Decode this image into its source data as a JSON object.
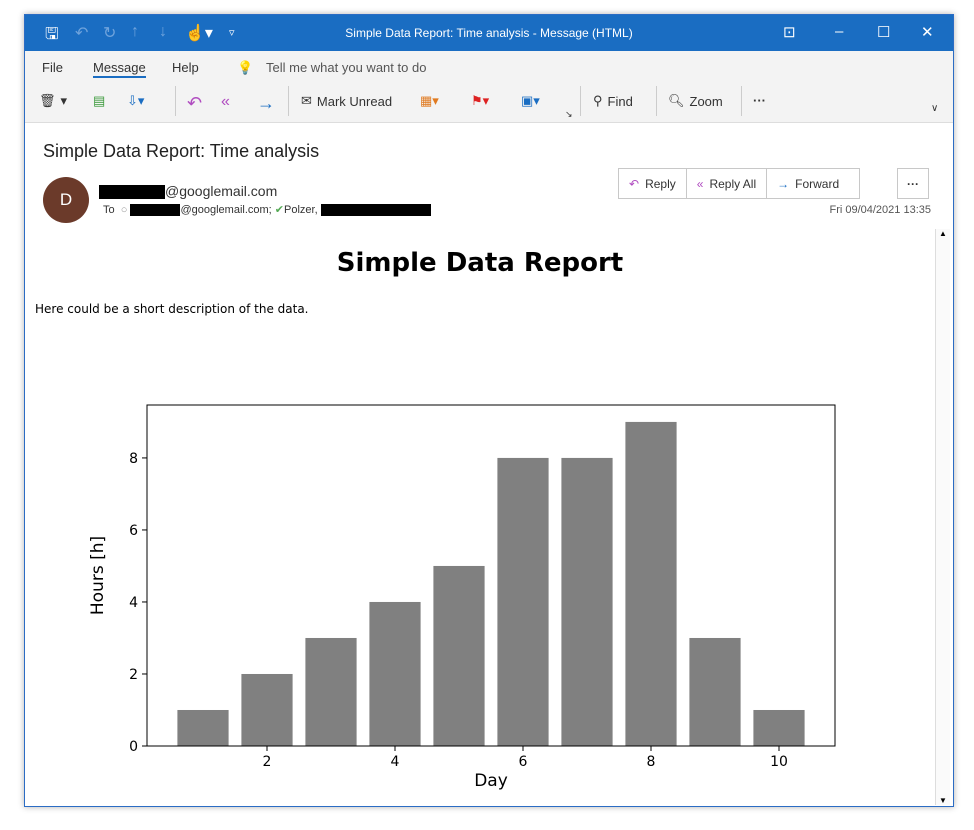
{
  "window": {
    "title": "Simple Data Report: Time analysis  -  Message (HTML)"
  },
  "ribbon": {
    "tabs": [
      "File",
      "Message",
      "Help"
    ],
    "tell_me": "Tell me what you want to do",
    "mark_unread": "Mark Unread",
    "find": "Find",
    "zoom": "Zoom",
    "more": "···"
  },
  "message": {
    "subject": "Simple Data Report: Time analysis",
    "avatar_initial": "D",
    "from_suffix": "@googlemail.com",
    "to_label": "To",
    "to_recipient_suffix": "@googlemail.com;",
    "to_recipient2": "Polzer,",
    "date": "Fri 09/04/2021 13:35",
    "reply": "Reply",
    "reply_all": "Reply All",
    "forward": "Forward",
    "more": "···"
  },
  "body": {
    "heading": "Simple Data Report",
    "description": "Here could be a short description of the data."
  },
  "colors": {
    "bar": "#808080",
    "titlebar": "#1a6dc2"
  },
  "chart_data": {
    "type": "bar",
    "categories": [
      1,
      2,
      3,
      4,
      5,
      6,
      7,
      8,
      9,
      10
    ],
    "values": [
      1,
      2,
      3,
      4,
      5,
      8,
      8,
      9,
      3,
      1
    ],
    "xlabel": "Day",
    "ylabel": "Hours [h]",
    "xticks": [
      2,
      4,
      6,
      8,
      10
    ],
    "yticks": [
      0,
      2,
      4,
      6,
      8
    ],
    "xlim": [
      0.125,
      10.875
    ],
    "ylim": [
      0,
      9.47
    ],
    "grid": false
  }
}
